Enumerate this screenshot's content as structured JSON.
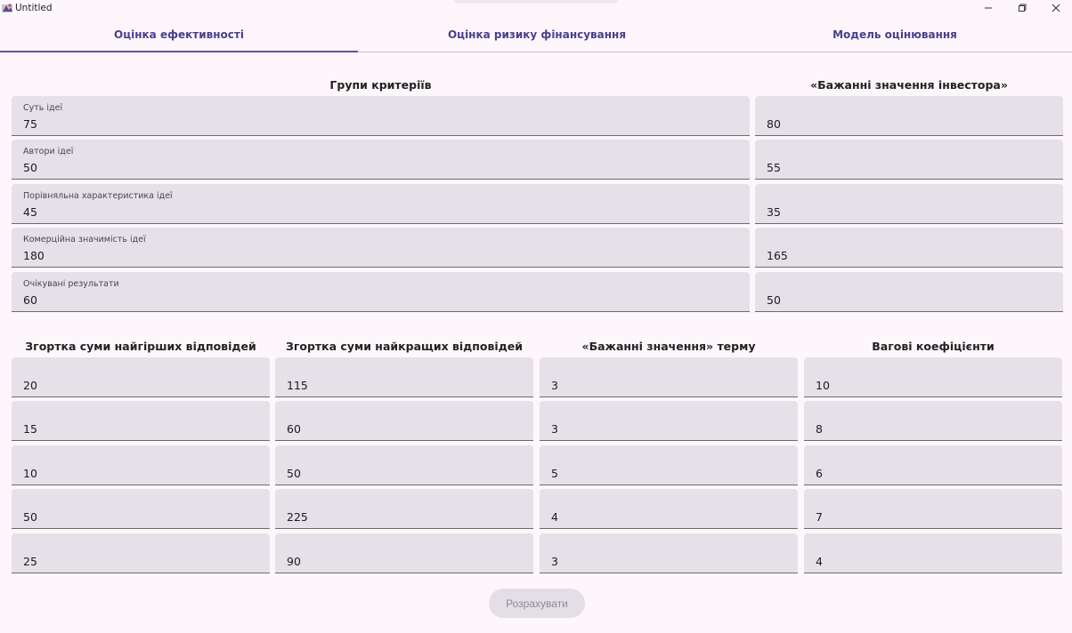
{
  "window": {
    "title": "Untitled"
  },
  "tabs": [
    {
      "label": "Оцінка ефективності"
    },
    {
      "label": "Оцінка ризику фінансування"
    },
    {
      "label": "Модель оцінювання"
    }
  ],
  "top_section": {
    "header_criteria": "Групи критеріїв",
    "header_investor": "«Бажанні значення інвестора»",
    "rows": [
      {
        "label": "Суть ідеї",
        "value": "75",
        "investor": "80"
      },
      {
        "label": "Автори ідеї",
        "value": "50",
        "investor": "55"
      },
      {
        "label": "Порівняльна характеристика ідеї",
        "value": "45",
        "investor": "35"
      },
      {
        "label": "Комерційна значимість ідеї",
        "value": "180",
        "investor": "165"
      },
      {
        "label": "Очікувані результати",
        "value": "60",
        "investor": "50"
      }
    ]
  },
  "bottom_section": {
    "headers": [
      "Згортка суми найгірших відповідей",
      "Згортка суми найкращих відповідей",
      "«Бажанні значення» терму",
      "Вагові коефіцієнти"
    ],
    "columns": [
      [
        "20",
        "15",
        "10",
        "50",
        "25"
      ],
      [
        "115",
        "60",
        "50",
        "225",
        "90"
      ],
      [
        "3",
        "3",
        "5",
        "4",
        "3"
      ],
      [
        "10",
        "8",
        "6",
        "7",
        "4"
      ]
    ]
  },
  "calculate_button": "Розрахувати"
}
